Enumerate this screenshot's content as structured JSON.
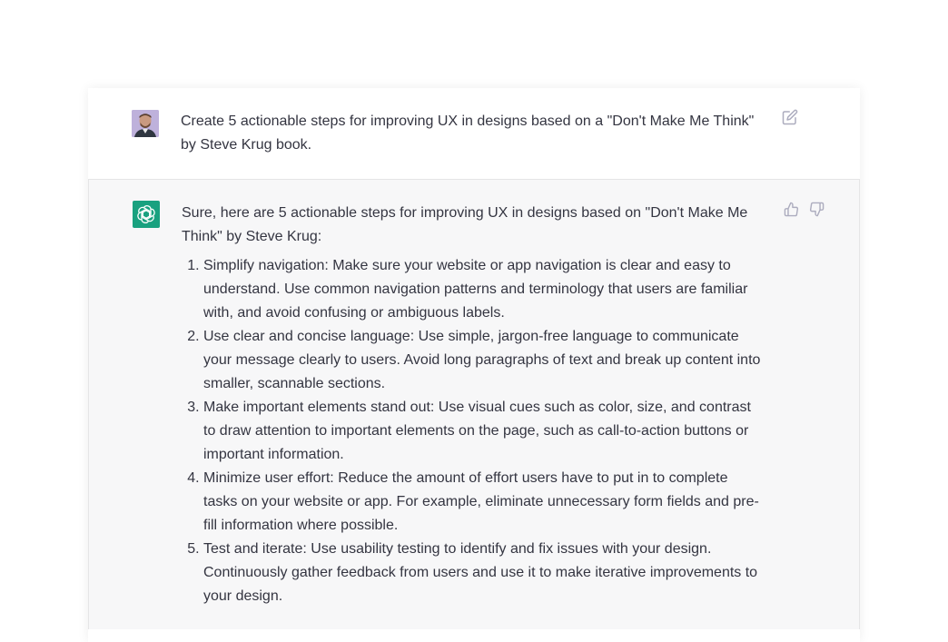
{
  "conversation": {
    "user_message": {
      "avatar": "user-photo",
      "text": "Create 5 actionable steps for improving UX in designs based on a \"Don't Make Me Think\" by Steve Krug book.",
      "edit_icon": "edit-icon"
    },
    "assistant_message": {
      "avatar": "openai-logo-icon",
      "intro": "Sure, here are 5 actionable steps for improving UX in designs based on \"Don't Make Me Think\" by Steve Krug:",
      "steps": [
        "Simplify navigation: Make sure your website or app navigation is clear and easy to understand. Use common navigation patterns and terminology that users are familiar with, and avoid confusing or ambiguous labels.",
        "Use clear and concise language: Use simple, jargon-free language to communicate your message clearly to users. Avoid long paragraphs of text and break up content into smaller, scannable sections.",
        "Make important elements stand out: Use visual cues such as color, size, and contrast to draw attention to important elements on the page, such as call-to-action buttons or important information.",
        "Minimize user effort: Reduce the amount of effort users have to put in to complete tasks on your website or app. For example, eliminate unnecessary form fields and pre-fill information where possible.",
        "Test and iterate: Use usability testing to identify and fix issues with your design. Continuously gather feedback from users and use it to make iterative improvements to your design."
      ],
      "feedback_icons": [
        "thumbs-up-icon",
        "thumbs-down-icon"
      ]
    }
  },
  "colors": {
    "assistant_bg": "#f7f7f8",
    "brand_green": "#19a17f",
    "text": "#343541",
    "icon": "#acacbe"
  }
}
